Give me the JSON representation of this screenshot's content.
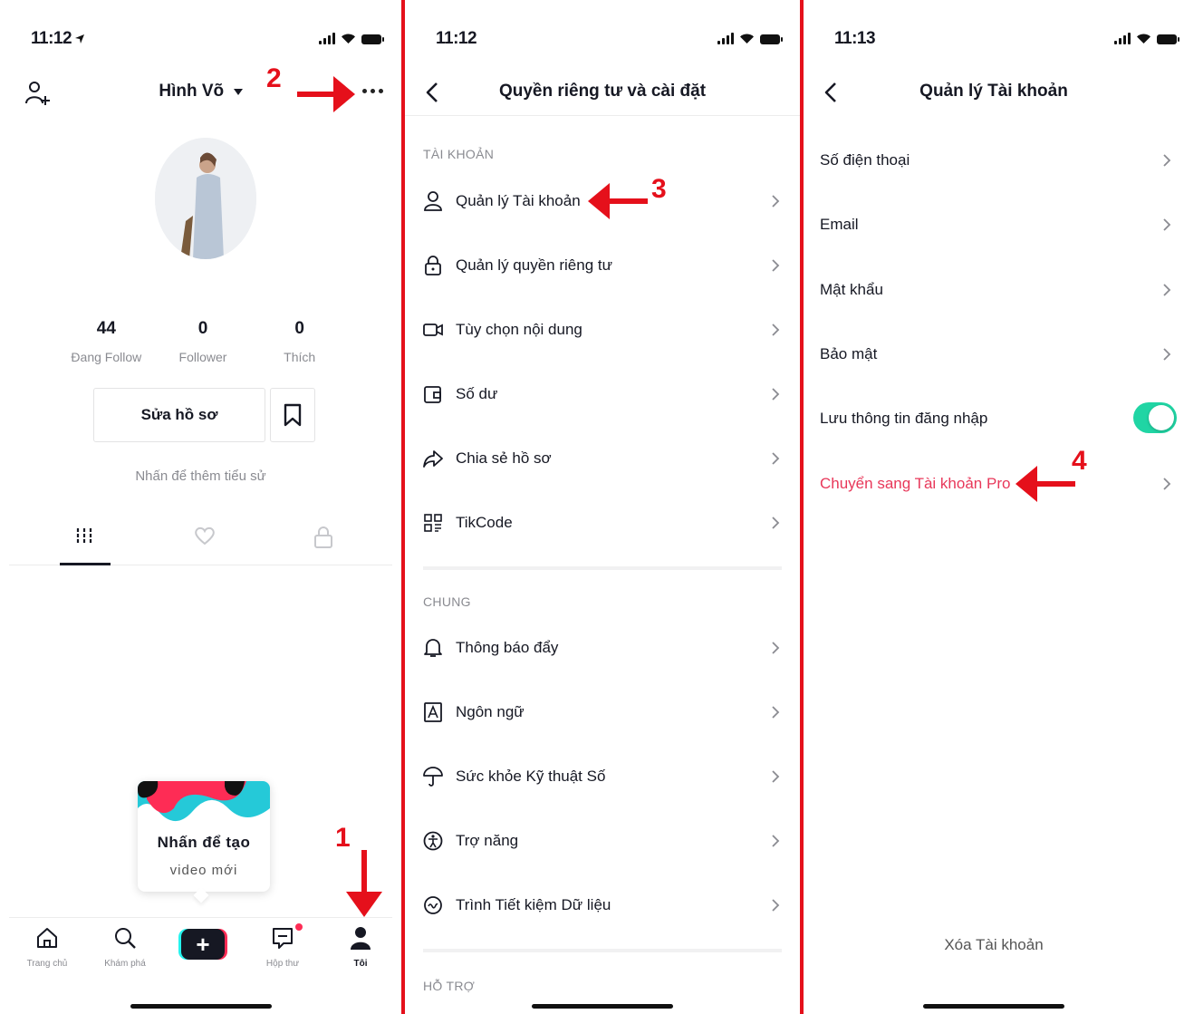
{
  "colors": {
    "accent": "#fe2c55",
    "annotation": "#e5101b",
    "toggle_on": "#20d5a4",
    "text_secondary": "#8a8b91"
  },
  "annotations": {
    "step1": "1",
    "step2": "2",
    "step3": "3",
    "step4": "4"
  },
  "profile": {
    "time": "11:12",
    "username": "Hình Võ",
    "stats": [
      {
        "value": "44",
        "label": "Đang Follow"
      },
      {
        "value": "0",
        "label": "Follower"
      },
      {
        "value": "0",
        "label": "Thích"
      }
    ],
    "edit_label": "Sửa hồ sơ",
    "bio_hint": "Nhấn để thêm tiểu sử",
    "tooltip_line1": "Nhấn để tạo",
    "tooltip_line2": "video mới",
    "tabbar": [
      {
        "label": "Trang chủ",
        "icon": "home-icon"
      },
      {
        "label": "Khám phá",
        "icon": "search-icon"
      },
      {
        "label": "",
        "icon": "plus-icon"
      },
      {
        "label": "Hộp thư",
        "icon": "inbox-icon"
      },
      {
        "label": "Tôi",
        "icon": "profile-icon"
      }
    ]
  },
  "settings": {
    "time": "11:12",
    "title": "Quyền riêng tư và cài đặt",
    "account_header": "TÀI KHOẢN",
    "general_header": "CHUNG",
    "support_header": "HỖ TRỢ",
    "account_items": [
      {
        "label": "Quản lý Tài khoản",
        "icon": "user-icon"
      },
      {
        "label": "Quản lý quyền riêng tư",
        "icon": "lock-icon"
      },
      {
        "label": "Tùy chọn nội dung",
        "icon": "video-icon"
      },
      {
        "label": "Số dư",
        "icon": "wallet-icon"
      },
      {
        "label": "Chia sẻ hồ sơ",
        "icon": "share-icon"
      },
      {
        "label": "TikCode",
        "icon": "qr-icon"
      }
    ],
    "general_items": [
      {
        "label": "Thông báo đẩy",
        "icon": "bell-icon"
      },
      {
        "label": "Ngôn ngữ",
        "icon": "language-icon"
      },
      {
        "label": "Sức khỏe Kỹ thuật Số",
        "icon": "umbrella-icon"
      },
      {
        "label": "Trợ năng",
        "icon": "accessibility-icon"
      },
      {
        "label": "Trình Tiết kiệm Dữ liệu",
        "icon": "data-saver-icon"
      }
    ]
  },
  "account": {
    "time": "11:13",
    "title": "Quản lý Tài khoản",
    "items": [
      {
        "label": "Số điện thoại"
      },
      {
        "label": "Email"
      },
      {
        "label": "Mật khẩu"
      },
      {
        "label": "Bảo mật"
      }
    ],
    "save_login_label": "Lưu thông tin đăng nhập",
    "save_login_on": true,
    "pro_label": "Chuyển sang Tài khoản Pro",
    "delete_label": "Xóa Tài khoản"
  }
}
